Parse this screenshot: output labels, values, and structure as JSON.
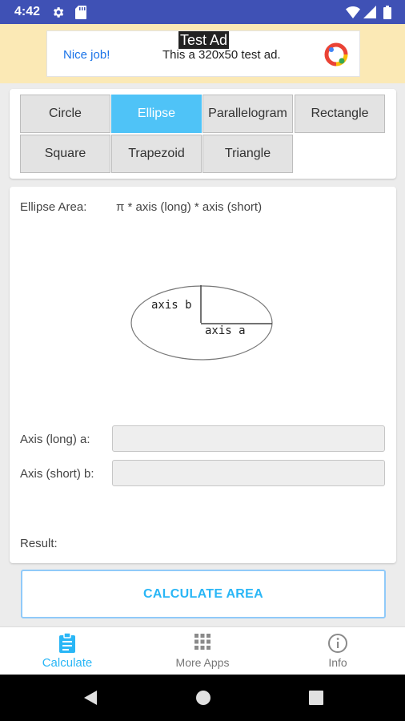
{
  "status_bar": {
    "time": "4:42",
    "left_icons": [
      "gear-icon",
      "sd-card-icon"
    ],
    "right_icons": [
      "wifi-icon",
      "signal-icon",
      "battery-icon"
    ]
  },
  "ad": {
    "badge": "Test Ad",
    "nice_job": "Nice job!",
    "text": "This a 320x50 test ad."
  },
  "shapes": {
    "items": [
      {
        "label": "Circle",
        "active": false
      },
      {
        "label": "Ellipse",
        "active": true
      },
      {
        "label": "Parallelogram",
        "active": false
      },
      {
        "label": "Rectangle",
        "active": false
      },
      {
        "label": "Square",
        "active": false
      },
      {
        "label": "Trapezoid",
        "active": false
      },
      {
        "label": "Triangle",
        "active": false
      }
    ]
  },
  "formula": {
    "label": "Ellipse Area:",
    "expression": "π * axis (long) * axis (short)"
  },
  "diagram": {
    "axis_b_label": "axis b",
    "axis_a_label": "axis a"
  },
  "fields": {
    "axis_long_label": "Axis (long) a:",
    "axis_long_value": "",
    "axis_short_label": "Axis (short) b:",
    "axis_short_value": ""
  },
  "result": {
    "label": "Result:"
  },
  "calculate_button": "CALCULATE AREA",
  "bottom_nav": {
    "items": [
      {
        "label": "Calculate",
        "icon": "clipboard-icon",
        "active": true
      },
      {
        "label": "More Apps",
        "icon": "apps-grid-icon",
        "active": false
      },
      {
        "label": "Info",
        "icon": "info-icon",
        "active": false
      }
    ]
  },
  "colors": {
    "status_bar": "#3f51b5",
    "ad_background": "#fbe9b5",
    "accent": "#29b6f6",
    "active_tab": "#4fc3f7"
  }
}
